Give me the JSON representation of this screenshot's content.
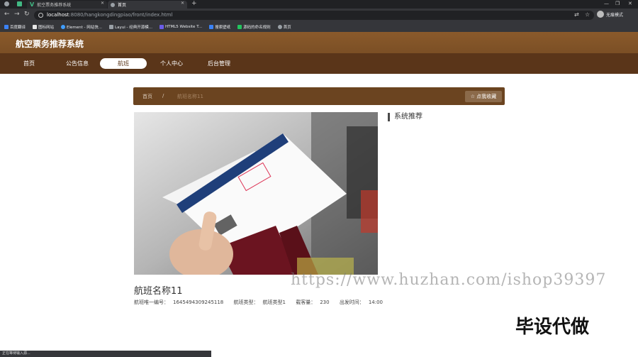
{
  "browser": {
    "tabs": [
      {
        "label": "航空票务推荐系统",
        "active": false
      },
      {
        "label": "首页",
        "active": true
      }
    ],
    "url_host": "localhost",
    "url_path": ":8080/hangkongdingpiao/front/index.html",
    "profile_label": "无痕模式",
    "bookmarks": [
      "百度翻译",
      "图标网站",
      "Element - 网站快...",
      "Layui - 经典开源模...",
      "HTML5 Website T...",
      "搜索壁纸",
      "源码的命名规则",
      "首页"
    ],
    "status": "正在等待输入源..."
  },
  "site": {
    "title": "航空票务推荐系统",
    "nav": [
      {
        "label": "首页",
        "active": false
      },
      {
        "label": "公告信息",
        "active": false
      },
      {
        "label": "航班",
        "active": true
      },
      {
        "label": "个人中心",
        "active": false
      },
      {
        "label": "后台管理",
        "active": false
      }
    ]
  },
  "breadcrumb": {
    "home": "首页",
    "sep": "/",
    "current": "航班名称11"
  },
  "favorite_button": "☆ 点我收藏",
  "sidebar": {
    "title": "系统推荐"
  },
  "flight": {
    "name": "航班名称11",
    "fields": [
      {
        "label": "航班唯一编号：",
        "value": "1645494309245118"
      },
      {
        "label": "航班类型：",
        "value": "航班类型1"
      },
      {
        "label": "载客量：",
        "value": "230"
      },
      {
        "label": "出发时间：",
        "value": "14:00"
      }
    ]
  },
  "watermark": {
    "url": "https://www.huzhan.com/ishop39397",
    "text": "毕设代做"
  },
  "colors": {
    "header": "#7b4f25",
    "nav": "#5a3519",
    "crumb_bar": "#6b4420"
  }
}
